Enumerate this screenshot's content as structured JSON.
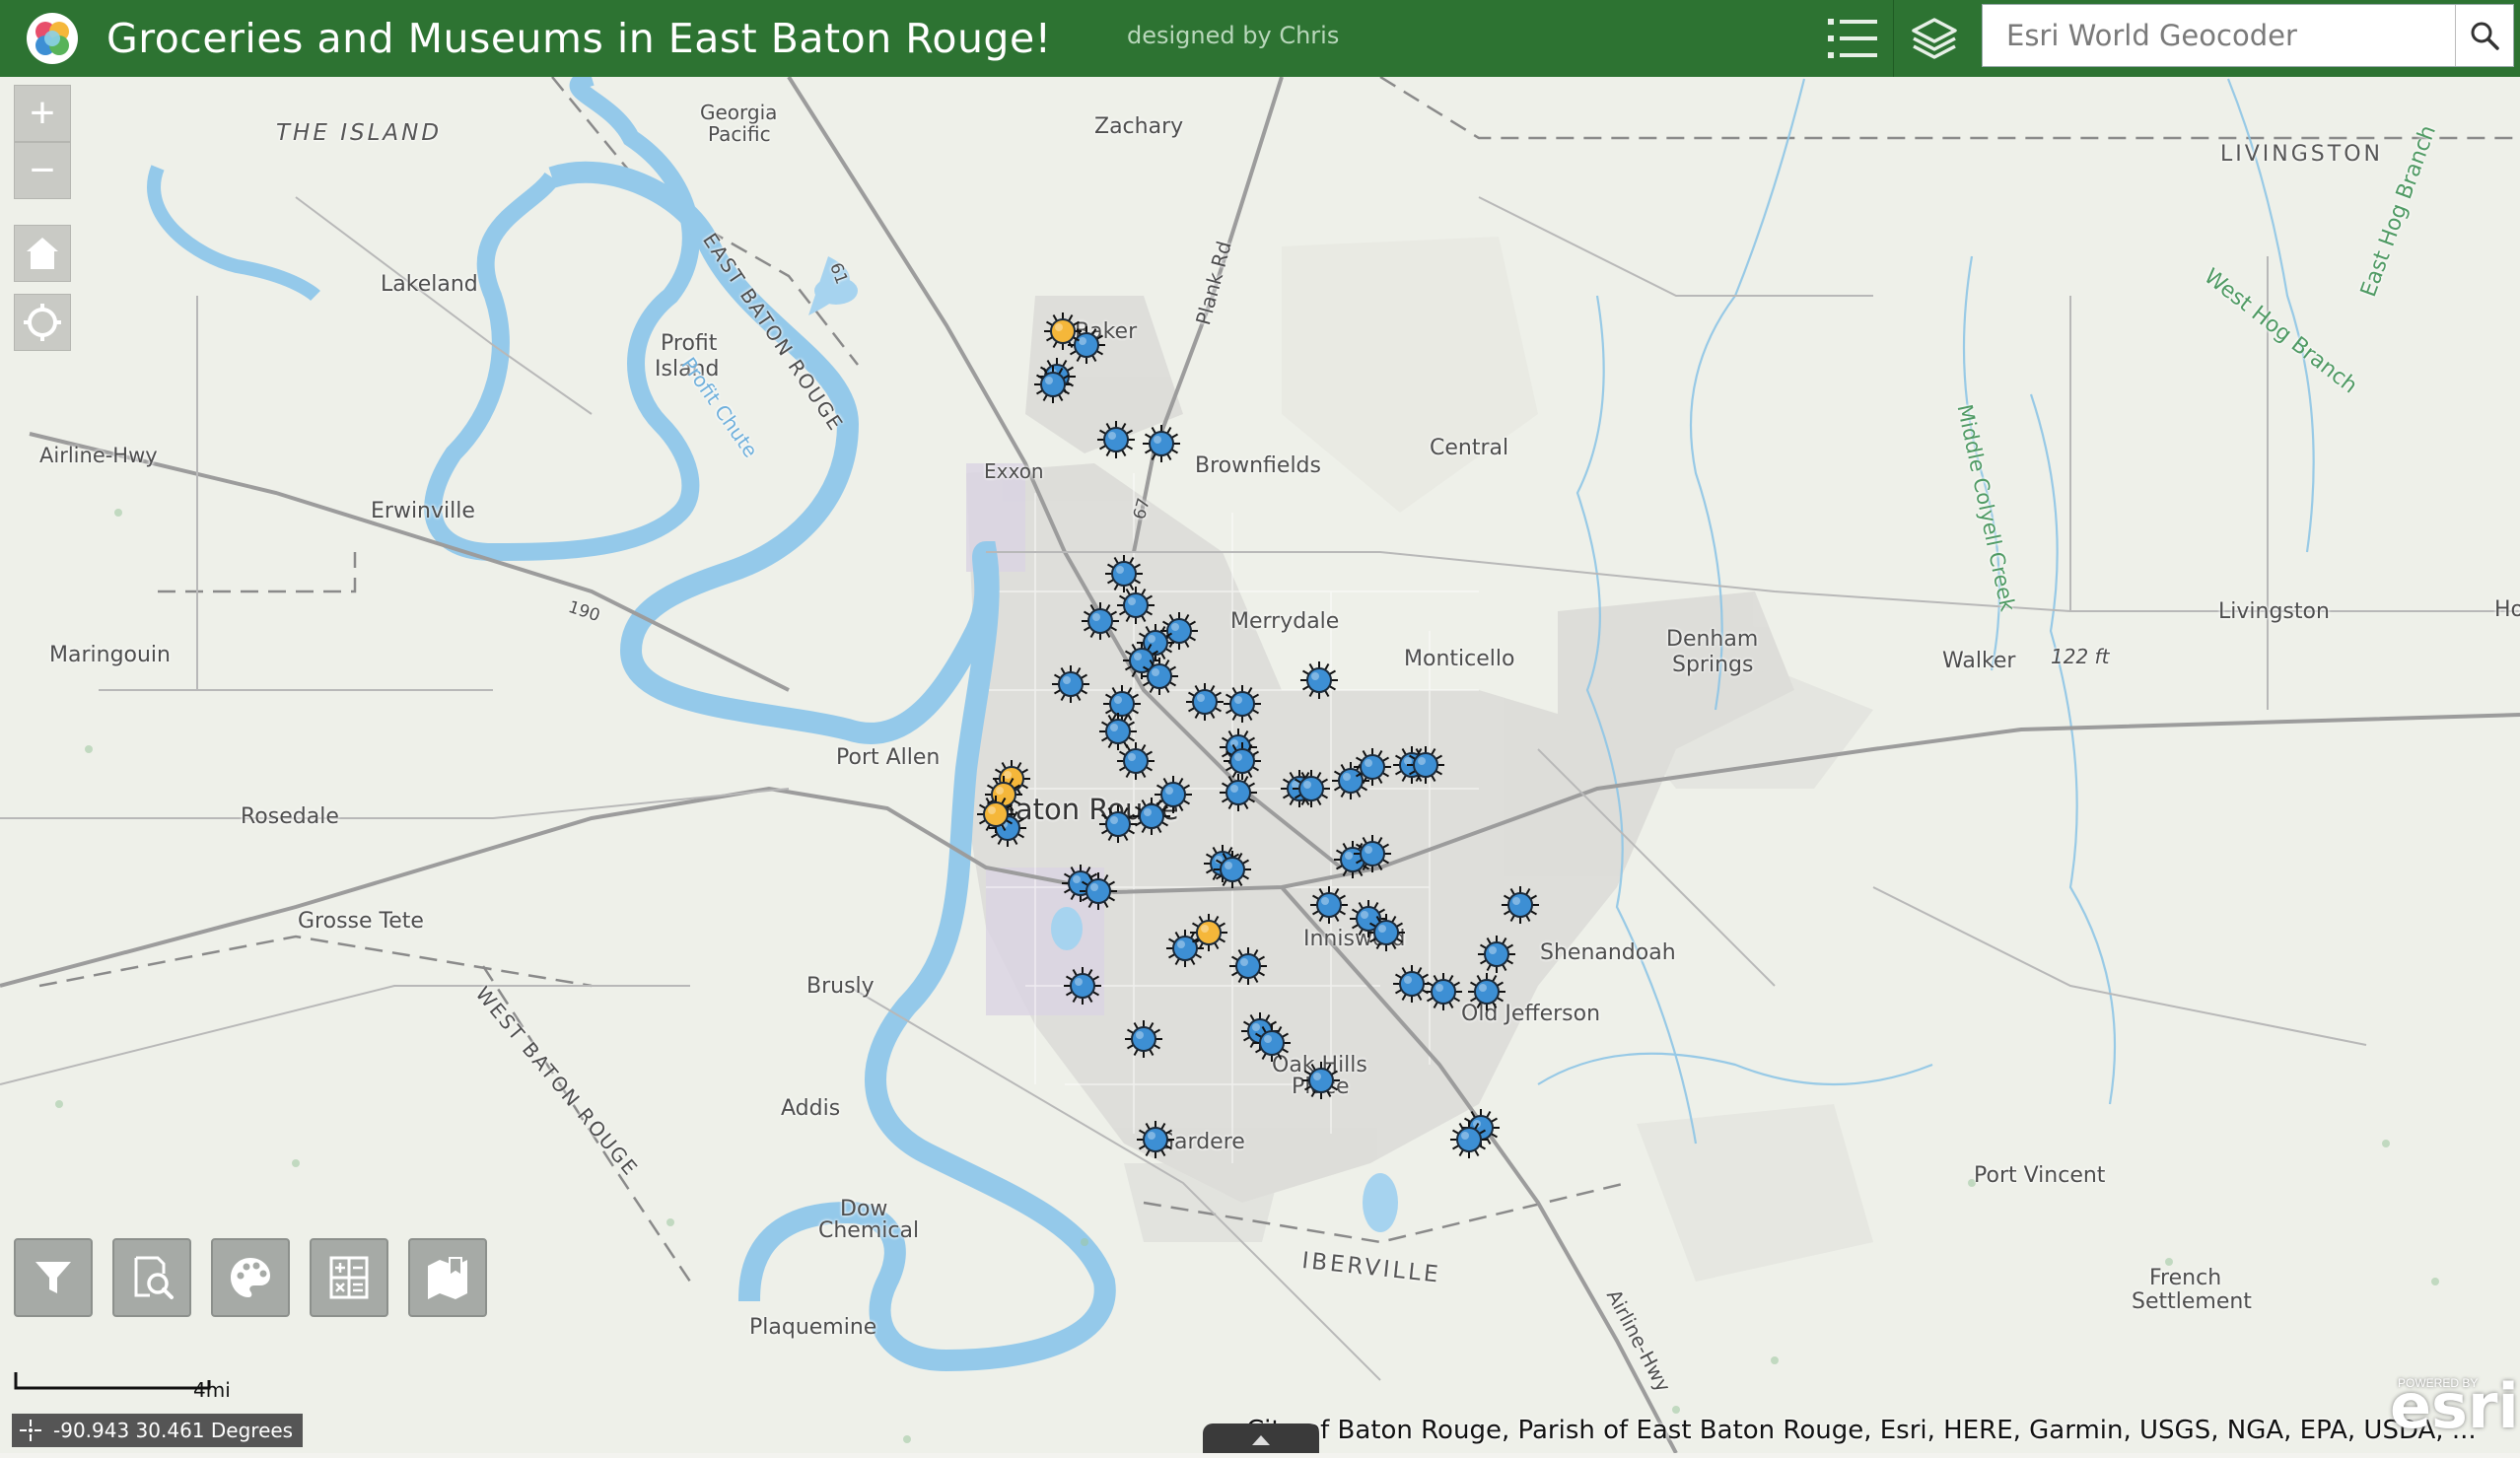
{
  "header": {
    "title": "Groceries and Museums in East Baton Rouge!",
    "subtitle": "designed by Chris",
    "search_placeholder": "Esri World Geocoder",
    "bg_color": "#2d7332"
  },
  "map": {
    "places": [
      {
        "label": "THE ISLAND",
        "style": "big"
      },
      {
        "label": "Georgia"
      },
      {
        "label": "Pacific"
      },
      {
        "label": "Zachary"
      },
      {
        "label": "LIVINGSTON",
        "style": "big"
      },
      {
        "label": "Lakeland"
      },
      {
        "label": "Profit"
      },
      {
        "label": "Island"
      },
      {
        "label": "Profit Chute"
      },
      {
        "label": "EAST BATON ROUGE"
      },
      {
        "label": "Baker"
      },
      {
        "label": "Plank Rd"
      },
      {
        "label": "West Hog Branch"
      },
      {
        "label": "East Hog Branch"
      },
      {
        "label": "Airline-Hwy"
      },
      {
        "label": "Exxon"
      },
      {
        "label": "Brownfields"
      },
      {
        "label": "Central"
      },
      {
        "label": "Middle Colyell Creek"
      },
      {
        "label": "Erwinville"
      },
      {
        "label": "190"
      },
      {
        "label": "61"
      },
      {
        "label": "67"
      },
      {
        "label": "Merrydale"
      },
      {
        "label": "Livingston"
      },
      {
        "label": "Maringouin"
      },
      {
        "label": "Monticello"
      },
      {
        "label": "Denham"
      },
      {
        "label": "Springs"
      },
      {
        "label": "Walker"
      },
      {
        "label": "122 ft"
      },
      {
        "label": "Port Allen"
      },
      {
        "label": "Baton Rouge"
      },
      {
        "label": "Rosedale"
      },
      {
        "label": "Grosse Tete"
      },
      {
        "label": "Inniswold"
      },
      {
        "label": "Shenandoah"
      },
      {
        "label": "Brusly"
      },
      {
        "label": "Old Jefferson"
      },
      {
        "label": "WEST BATON ROUGE"
      },
      {
        "label": "Oak Hills"
      },
      {
        "label": "Place"
      },
      {
        "label": "Addis"
      },
      {
        "label": "Gardere"
      },
      {
        "label": "Port Vincent"
      },
      {
        "label": "Dow"
      },
      {
        "label": "Chemical"
      },
      {
        "label": "IBERVILLE",
        "style": "big"
      },
      {
        "label": "French"
      },
      {
        "label": "Settlement"
      },
      {
        "label": "Airline-Hwy"
      },
      {
        "label": "Plaquemine"
      },
      {
        "label": "Ho"
      }
    ],
    "markers": {
      "grocery_color": "#3d8fd4",
      "museum_color": "#f5b73a"
    }
  },
  "controls": {
    "zoom_in": "+",
    "zoom_out": "−"
  },
  "toolbar": [
    {
      "name": "filter-tool-button",
      "icon": "filter-icon"
    },
    {
      "name": "query-tool-button",
      "icon": "magnify-document-icon"
    },
    {
      "name": "style-tool-button",
      "icon": "palette-icon"
    },
    {
      "name": "calculator-tool-button",
      "icon": "calculator-icon"
    },
    {
      "name": "bookmark-tool-button",
      "icon": "map-bookmark-icon"
    }
  ],
  "scale": {
    "label": "4mi"
  },
  "coordinates": {
    "text": "-90.943 30.461 Degrees"
  },
  "attribution": {
    "text": "City of Baton Rouge, Parish of East Baton Rouge, Esri, HERE, Garmin, USGS, NGA, EPA, USDA, ..."
  },
  "branding": {
    "powered_by": "POWERED BY",
    "logo": "esri"
  }
}
